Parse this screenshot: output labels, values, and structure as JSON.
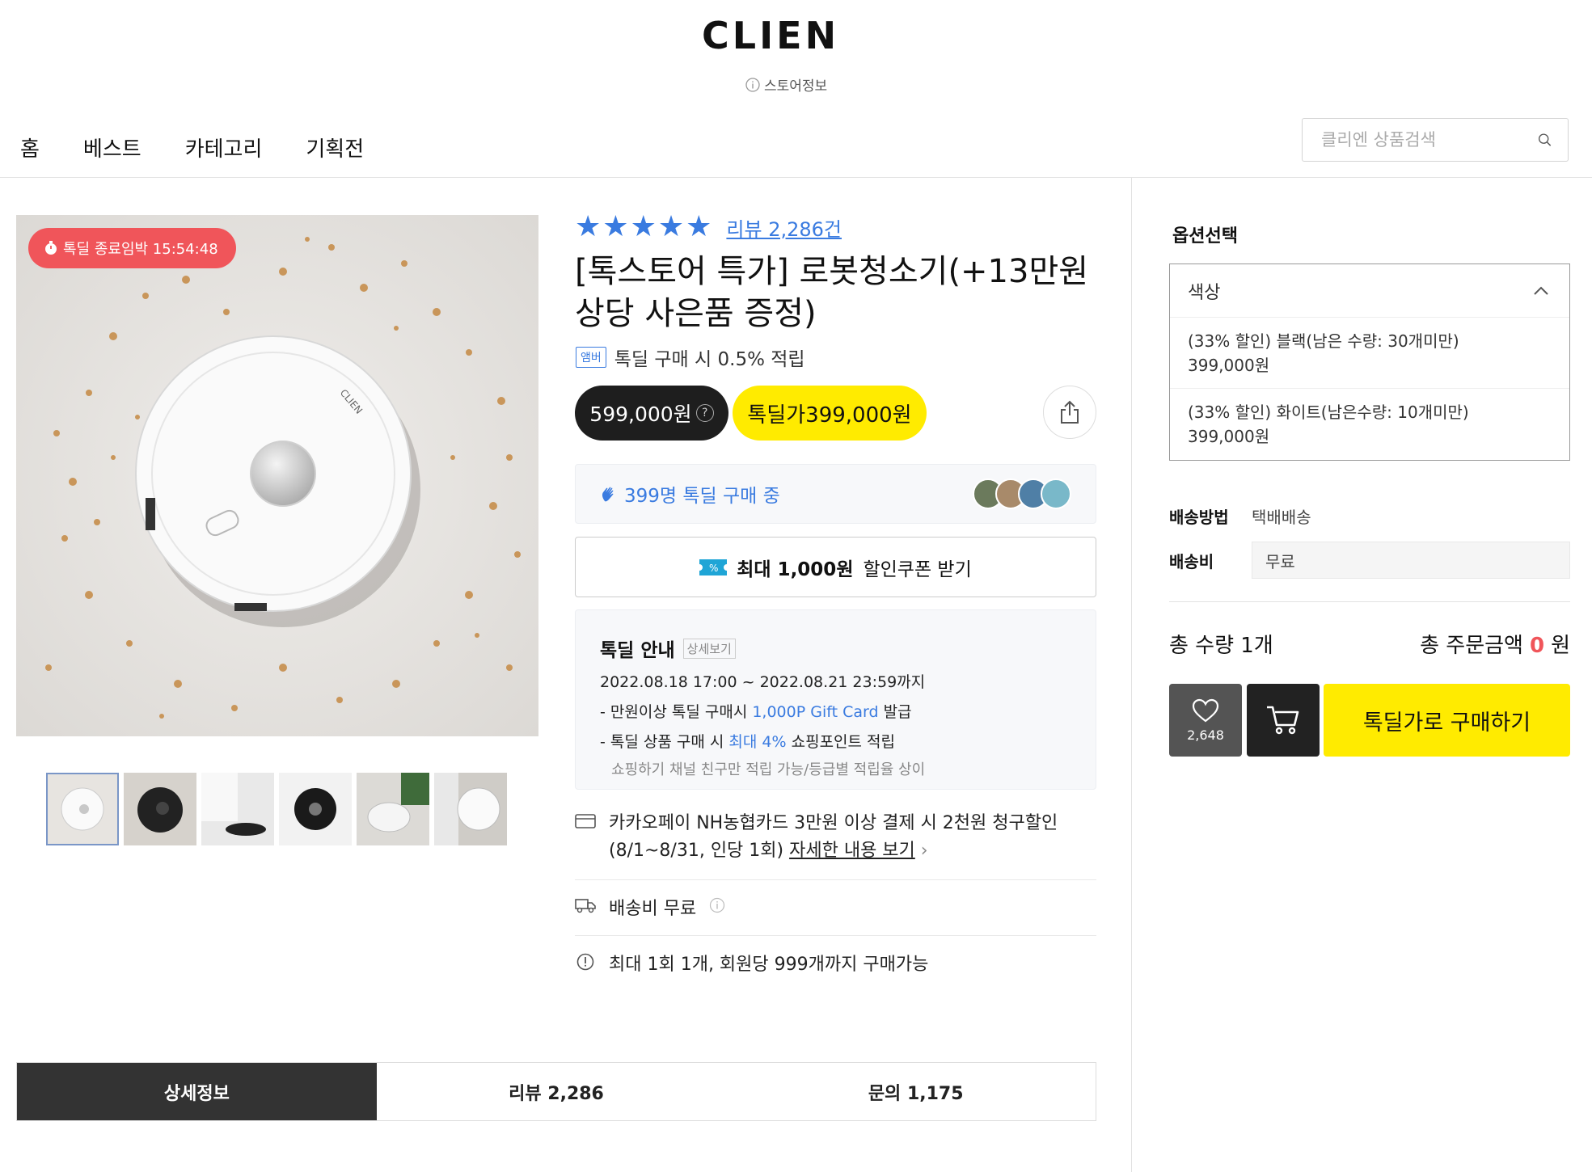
{
  "header": {
    "logo_text": "CLIEN",
    "store_info": "스토어정보",
    "nav": [
      "홈",
      "베스트",
      "카테고리",
      "기획전"
    ],
    "search_placeholder": "클리엔 상품검색"
  },
  "product": {
    "timer_label": "톡딜 종료임박 15:54:48",
    "review_link": "리뷰 2,286건",
    "rating_stars": 5,
    "title": "[톡스토어 특가] 로봇청소기(+13만원 상당 사은품 증정)",
    "amber_badge": "앰버",
    "amber_text": "톡딜 구매 시 0.5% 적립",
    "price_regular": "599,000원",
    "price_deal": "톡딜가399,000원",
    "buying_now": "399명 톡딜 구매 중",
    "coupon_prefix": "최대 1,000원",
    "coupon_suffix": "할인쿠폰 받기",
    "thumbnail_count": 6,
    "deal_info": {
      "title": "톡딜 안내",
      "detail_link": "상세보기",
      "period": "2022.08.18 17:00 ~ 2022.08.21 23:59까지",
      "line1_pre": "- 만원이상 톡딜 구매시 ",
      "line1_blue": "1,000P Gift Card",
      "line1_post": " 발급",
      "line2_pre": "- 톡딜 상품 구매 시 ",
      "line2_blue": "최대 4%",
      "line2_post": " 쇼핑포인트 적립",
      "line3": "쇼핑하기 채널 친구만 적립 가능/등급별 적립율 상이"
    },
    "card_promo_line1": "카카오페이 NH농협카드 3만원 이상 결제 시 2천원 청구할인",
    "card_promo_line2": "(8/1~8/31, 인당 1회) ",
    "card_promo_link": "자세한 내용 보기",
    "shipping_text": "배송비 무료",
    "limit_text": "최대 1회 1개, 회원당 999개까지 구매가능"
  },
  "tabs": [
    "상세정보",
    "리뷰 2,286",
    "문의 1,175"
  ],
  "sidebar": {
    "option_title": "옵션선택",
    "option_header": "색상",
    "options": [
      {
        "name": "(33% 할인) 블랙(남은 수량: 30개미만)",
        "price": "399,000원"
      },
      {
        "name": "(33% 할인) 화이트(남은수량: 10개미만)",
        "price": "399,000원"
      }
    ],
    "ship_method_label": "배송방법",
    "ship_method_value": "택배배송",
    "ship_fee_label": "배송비",
    "ship_fee_value": "무료",
    "total_qty": "총 수량 1개",
    "total_amount_label": "총 주문금액",
    "total_amount_value": "0",
    "total_amount_unit": "원",
    "like_count": "2,648",
    "buy_button": "톡딜가로 구매하기"
  },
  "colors": {
    "accent_blue": "#3a7be0",
    "kakao_yellow": "#ffeb00",
    "timer_red": "#f0555a",
    "dark": "#1e1e1e"
  }
}
